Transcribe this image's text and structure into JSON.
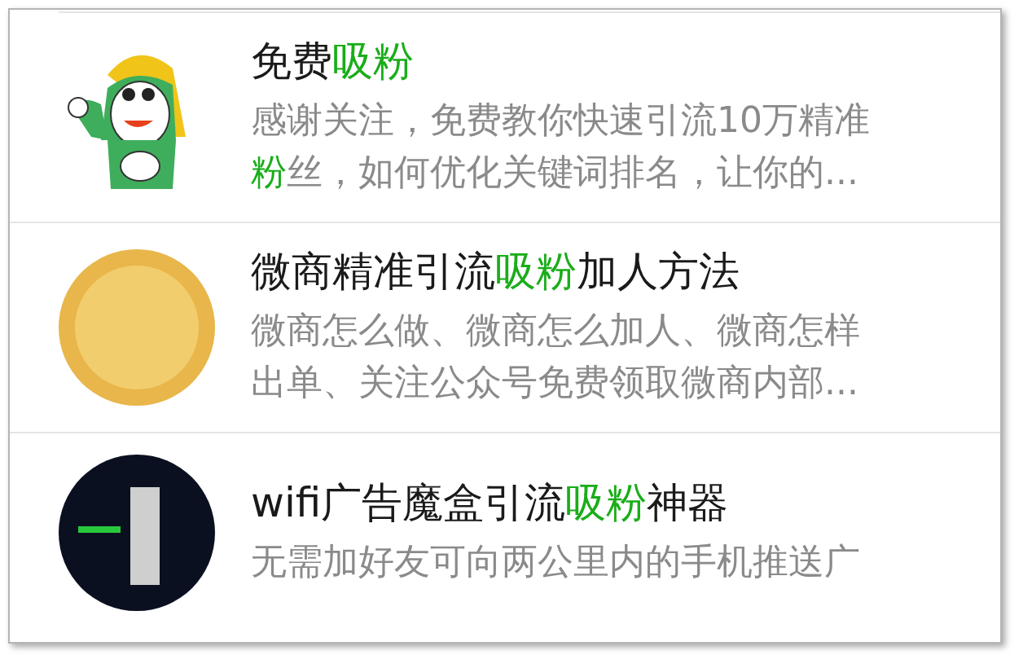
{
  "results": [
    {
      "kind": "cartoon",
      "title": [
        {
          "text": "免费",
          "highlight": false
        },
        {
          "text": "吸粉",
          "highlight": true
        }
      ],
      "description": [
        [
          {
            "text": "感谢关注，免费教你快速引流10万精准",
            "highlight": false
          }
        ],
        [
          {
            "text": "粉",
            "highlight": true
          },
          {
            "text": "丝，如何优化关键词排名，让你的...",
            "highlight": false
          }
        ]
      ]
    },
    {
      "kind": "gold",
      "title": [
        {
          "text": "微商精准引流",
          "highlight": false
        },
        {
          "text": "吸粉",
          "highlight": true
        },
        {
          "text": "加人方法",
          "highlight": false
        }
      ],
      "description": [
        [
          {
            "text": "微商怎么做、微商怎么加人、微商怎样",
            "highlight": false
          }
        ],
        [
          {
            "text": "出单、关注公众号免费领取微商内部...",
            "highlight": false
          }
        ]
      ]
    },
    {
      "kind": "dark",
      "title": [
        {
          "text": "wifi广告魔盒引流",
          "highlight": false
        },
        {
          "text": "吸粉",
          "highlight": true
        },
        {
          "text": "神器",
          "highlight": false
        }
      ],
      "description": [
        [
          {
            "text": "无需加好友可向两公里内的手机推送广",
            "highlight": false
          }
        ]
      ]
    }
  ]
}
